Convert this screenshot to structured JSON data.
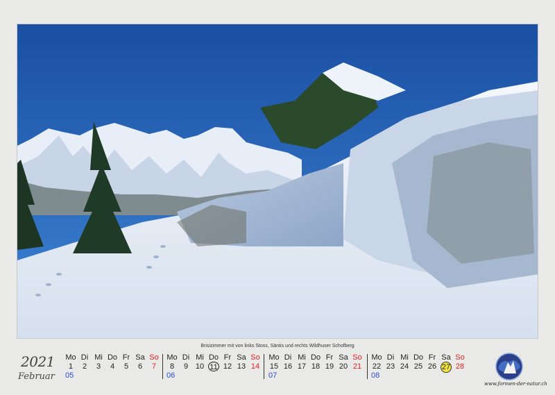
{
  "caption": "Brisizimmer mit von links Stoss, Säntis und rechts Wildhuser Schofberg",
  "year": "2021",
  "month": "Februar",
  "weekday_labels": [
    "Mo",
    "Di",
    "Mi",
    "Do",
    "Fr",
    "Sa",
    "So"
  ],
  "weeks": [
    {
      "kw": "05",
      "days": [
        "1",
        "2",
        "3",
        "4",
        "5",
        "6",
        "7"
      ]
    },
    {
      "kw": "06",
      "days": [
        "8",
        "9",
        "10",
        "11",
        "12",
        "13",
        "14"
      ]
    },
    {
      "kw": "07",
      "days": [
        "15",
        "16",
        "17",
        "18",
        "19",
        "20",
        "21"
      ]
    },
    {
      "kw": "08",
      "days": [
        "22",
        "23",
        "24",
        "25",
        "26",
        "27",
        "28"
      ]
    }
  ],
  "highlights": {
    "circled_day": "11",
    "yellow_day": "27"
  },
  "logo_text": "www.formen-der-natur.ch",
  "colors": {
    "sky": "#1f5cb0",
    "sunday": "#e02020",
    "week_number": "#2a4bd7",
    "highlight": "#f3e73b"
  },
  "icons": {
    "logo": "globe-logo-icon"
  }
}
